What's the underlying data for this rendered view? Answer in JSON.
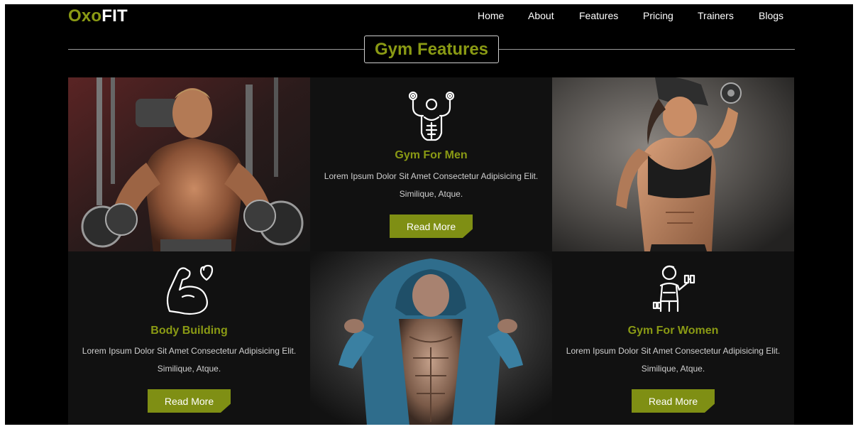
{
  "logo": {
    "part1": "Oxo",
    "part2": "FIT"
  },
  "nav": {
    "items": [
      {
        "label": "Home"
      },
      {
        "label": "About"
      },
      {
        "label": "Features"
      },
      {
        "label": "Pricing"
      },
      {
        "label": "Trainers"
      },
      {
        "label": "Blogs"
      }
    ]
  },
  "section": {
    "heading": "Gym Features"
  },
  "cards": [
    {
      "title": "Gym For Men",
      "description_line1": "Lorem Ipsum Dolor Sit Amet Consectetur Adipisicing Elit.",
      "description_line2": "Similique, Atque.",
      "button": "Read More",
      "icon": "muscle-man-icon"
    },
    {
      "title": "Body Building",
      "description_line1": "Lorem Ipsum Dolor Sit Amet Consectetur Adipisicing Elit.",
      "description_line2": "Similique, Atque.",
      "button": "Read More",
      "icon": "flexed-arm-heart-icon"
    },
    {
      "title": "Gym For Women",
      "description_line1": "Lorem Ipsum Dolor Sit Amet Consectetur Adipisicing Elit.",
      "description_line2": "Similique, Atque.",
      "button": "Read More",
      "icon": "woman-dumbbell-icon"
    }
  ],
  "colors": {
    "accent": "#8a9a14",
    "button": "#7f8f14",
    "background": "#000000",
    "card": "#111111",
    "text": "#cfcfcf"
  }
}
